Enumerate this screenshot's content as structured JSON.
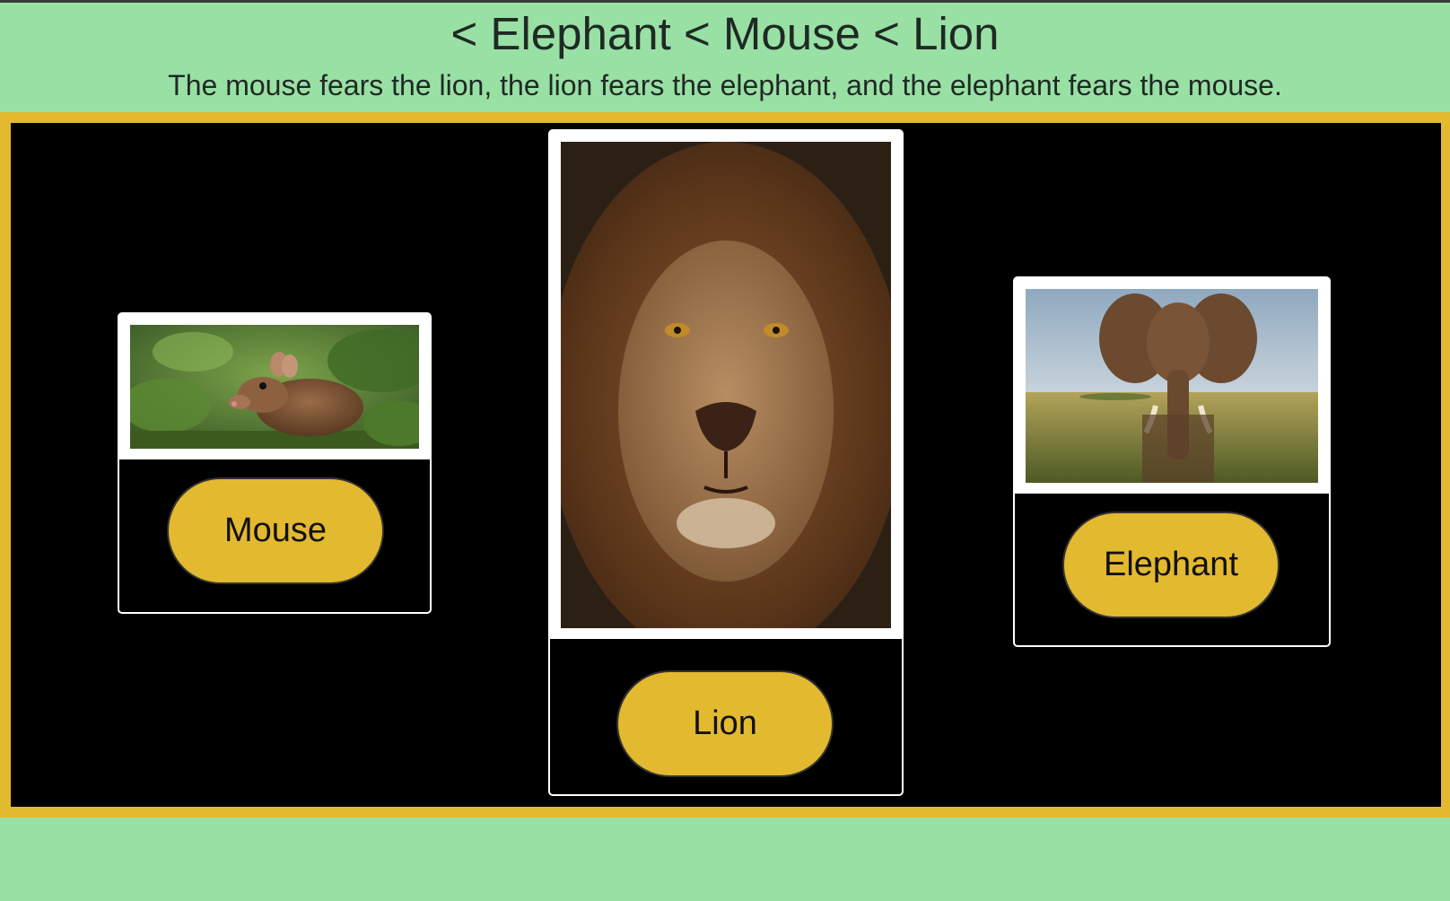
{
  "header": {
    "title": "< Elephant < Mouse < Lion",
    "subtitle": "The mouse fears the lion, the lion fears the elephant, and the elephant fears the mouse."
  },
  "cards": [
    {
      "id": "mouse",
      "button_label": "Mouse",
      "image": "mouse-photo"
    },
    {
      "id": "lion",
      "button_label": "Lion",
      "image": "lion-photo"
    },
    {
      "id": "elephant",
      "button_label": "Elephant",
      "image": "elephant-photo"
    }
  ],
  "colors": {
    "background": "#99e0a5",
    "accent": "#e3b92f",
    "stage": "#000000",
    "card_border": "#ffffff"
  }
}
